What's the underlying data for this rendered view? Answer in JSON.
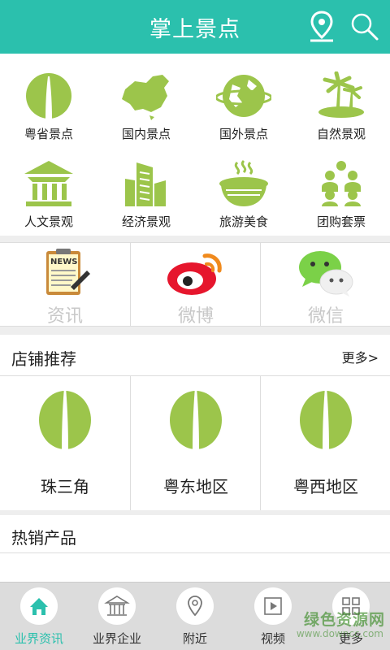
{
  "header": {
    "title": "掌上景点",
    "background": "#2bc0ad",
    "icons": [
      "location-pin-icon",
      "search-icon"
    ]
  },
  "categories": [
    {
      "label": "粤省景点",
      "icon": "canton-tower-icon"
    },
    {
      "label": "国内景点",
      "icon": "china-map-icon"
    },
    {
      "label": "国外景点",
      "icon": "globe-icon"
    },
    {
      "label": "自然景观",
      "icon": "palm-island-icon"
    },
    {
      "label": "人文景观",
      "icon": "pavilion-icon"
    },
    {
      "label": "经济景观",
      "icon": "buildings-icon"
    },
    {
      "label": "旅游美食",
      "icon": "noodle-bowl-icon"
    },
    {
      "label": "团购套票",
      "icon": "group-people-icon"
    }
  ],
  "social": [
    {
      "label": "资讯",
      "icon": "news-clipboard-icon"
    },
    {
      "label": "微博",
      "icon": "weibo-icon"
    },
    {
      "label": "微信",
      "icon": "wechat-icon"
    }
  ],
  "stores": {
    "title": "店铺推荐",
    "more": "更多>",
    "items": [
      {
        "label": "珠三角",
        "icon": "canton-tower-icon"
      },
      {
        "label": "粤东地区",
        "icon": "canton-tower-icon"
      },
      {
        "label": "粤西地区",
        "icon": "canton-tower-icon"
      }
    ]
  },
  "hot": {
    "title": "热销产品"
  },
  "tabbar": {
    "active_index": 0,
    "tabs": [
      {
        "label": "业界资讯",
        "icon": "home-icon"
      },
      {
        "label": "业界企业",
        "icon": "pavilion-icon"
      },
      {
        "label": "附近",
        "icon": "location-pin-icon"
      },
      {
        "label": "视频",
        "icon": "video-play-icon"
      },
      {
        "label": "更多",
        "icon": "grid-icon"
      }
    ]
  },
  "watermark": {
    "line1": "绿色资源网",
    "line2": "www.downcc.com"
  },
  "colors": {
    "accent": "#2bc0ad",
    "icon_green": "#9cc54b",
    "tab_bar": "#dcdcdc"
  }
}
